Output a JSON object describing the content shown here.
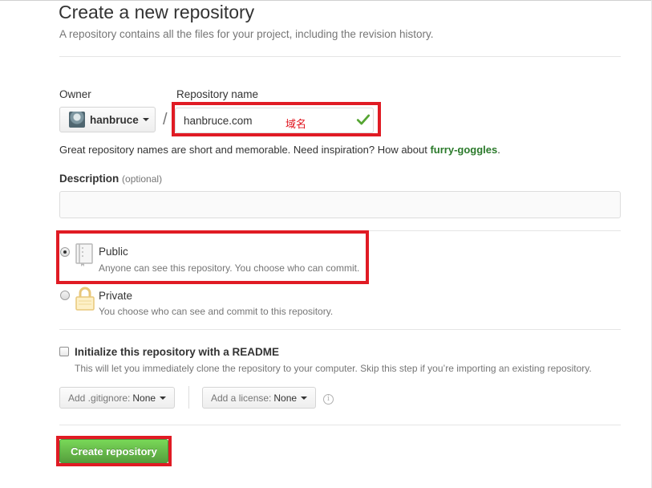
{
  "header": {
    "title": "Create a new repository",
    "subtitle": "A repository contains all the files for your project, including the revision history."
  },
  "owner": {
    "label": "Owner",
    "value": "hanbruce"
  },
  "separator": "/",
  "repository": {
    "label": "Repository name",
    "value": "hanbruce.com",
    "annotation": "域名",
    "valid_icon": "check-icon"
  },
  "hint": {
    "prefix": "Great repository names are short and memorable. Need inspiration? How about ",
    "suggestion": "furry-goggles",
    "suffix": "."
  },
  "description": {
    "label": "Description",
    "optional": "(optional)",
    "value": "",
    "placeholder": ""
  },
  "visibility": {
    "selected": "Public",
    "options": [
      {
        "title": "Public",
        "description": "Anyone can see this repository. You choose who can commit.",
        "icon": "book-icon"
      },
      {
        "title": "Private",
        "description": "You choose who can see and commit to this repository.",
        "icon": "lock-icon"
      }
    ]
  },
  "readme": {
    "label": "Initialize this repository with a README",
    "description": "This will let you immediately clone the repository to your computer. Skip this step if you’re importing an existing repository.",
    "checked": false
  },
  "gitignore": {
    "label": "Add .gitignore:",
    "value": "None"
  },
  "license": {
    "label": "Add a license:",
    "value": "None"
  },
  "info_icon": "i",
  "submit": {
    "label": "Create repository"
  },
  "colors": {
    "highlight": "#e01b24",
    "primary_button": "#5fb548",
    "suggestion": "#2b7a2b",
    "valid": "#55a532"
  }
}
